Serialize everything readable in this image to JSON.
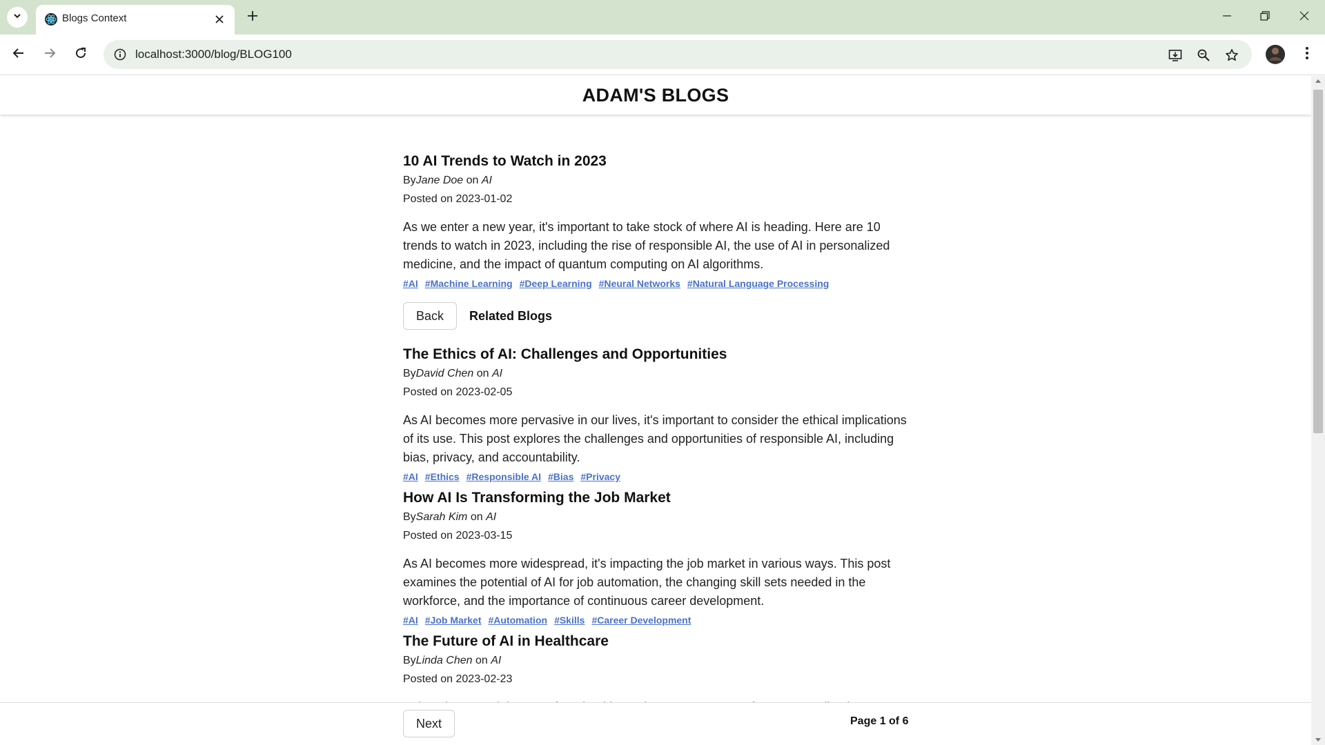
{
  "browser": {
    "tab_title": "Blogs Context",
    "url": "localhost:3000/blog/BLOG100"
  },
  "site": {
    "title": "ADAM'S BLOGS"
  },
  "post": {
    "title": "10 AI Trends to Watch in 2023",
    "by_prefix": "By",
    "author": "Jane Doe",
    "on_word": " on ",
    "category": "AI",
    "date_label": "Posted on 2023-01-02",
    "body": "As we enter a new year, it's important to take stock of where AI is heading. Here are 10 trends to watch in 2023, including the rise of responsible AI, the use of AI in personalized medicine, and the impact of quantum computing on AI algorithms.",
    "tags": [
      "#AI",
      "#Machine Learning",
      "#Deep Learning",
      "#Neural Networks",
      "#Natural Language Processing"
    ]
  },
  "actions": {
    "back_label": "Back",
    "related_label": "Related Blogs",
    "next_label": "Next",
    "page_indicator": "Page 1 of 6"
  },
  "related": [
    {
      "title": "The Ethics of AI: Challenges and Opportunities",
      "by_prefix": "By",
      "author": "David Chen",
      "on_word": " on ",
      "category": "AI",
      "date_label": "Posted on 2023-02-05",
      "body": "As AI becomes more pervasive in our lives, it's important to consider the ethical implications of its use. This post explores the challenges and opportunities of responsible AI, including bias, privacy, and accountability.",
      "tags": [
        "#AI",
        "#Ethics",
        "#Responsible AI",
        "#Bias",
        "#Privacy"
      ]
    },
    {
      "title": "How AI Is Transforming the Job Market",
      "by_prefix": "By",
      "author": "Sarah Kim",
      "on_word": " on ",
      "category": "AI",
      "date_label": "Posted on 2023-03-15",
      "body": "As AI becomes more widespread, it's impacting the job market in various ways. This post examines the potential of AI for job automation, the changing skill sets needed in the workforce, and the importance of continuous career development.",
      "tags": [
        "#AI",
        "#Job Market",
        "#Automation",
        "#Skills",
        "#Career Development"
      ]
    },
    {
      "title": "The Future of AI in Healthcare",
      "by_prefix": "By",
      "author": "Linda Chen",
      "on_word": " on ",
      "category": "AI",
      "date_label": "Posted on 2023-02-23",
      "body": "AI has the potential to transform healthcare in numerous ways, from personalized",
      "tags": []
    }
  ],
  "icons": {
    "tab_search": "chevron-down-icon",
    "favicon": "react-atom-icon",
    "tab_close": "close-icon",
    "new_tab": "plus-icon",
    "back": "arrow-left-icon",
    "forward": "arrow-right-icon",
    "reload": "reload-icon",
    "site_info": "info-icon",
    "install": "install-app-icon",
    "zoom": "zoom-icon",
    "bookmark": "star-icon",
    "menu": "kebab-menu-icon"
  },
  "colors": {
    "tabbar_bg": "#d3e3cd",
    "omnibox_bg": "#eaf0ea",
    "tag_link": "#4a72c8"
  }
}
